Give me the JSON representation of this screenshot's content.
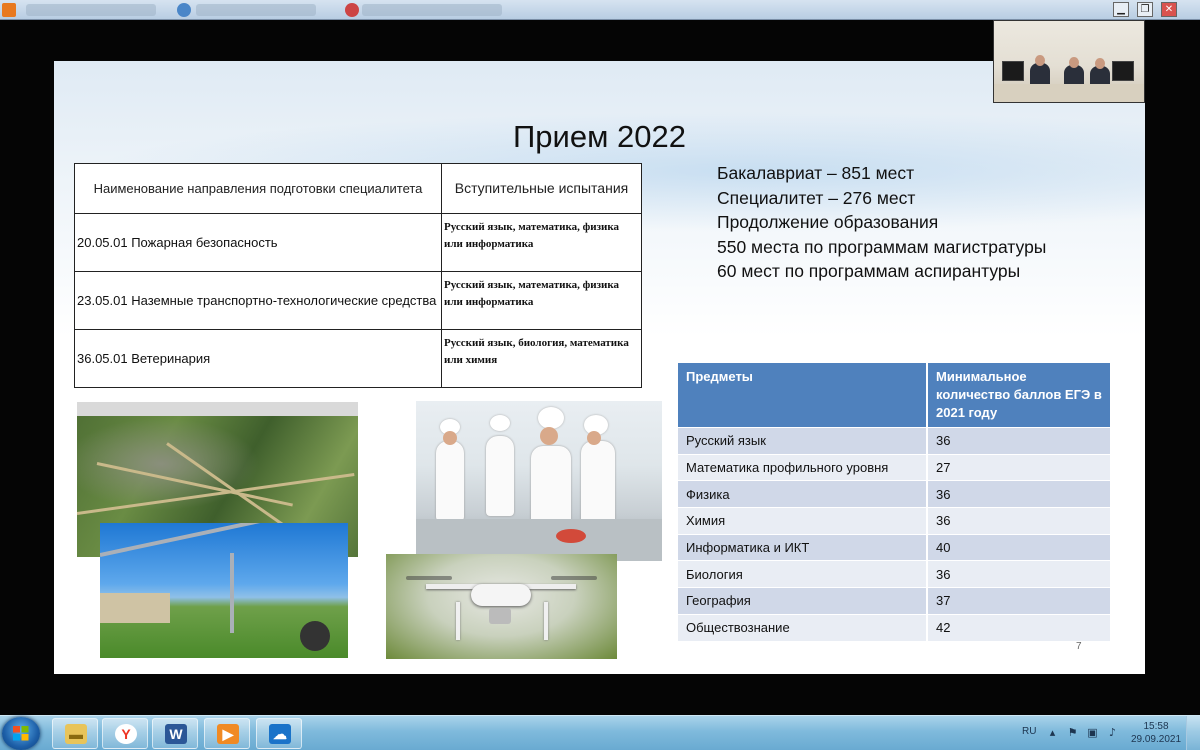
{
  "window": {
    "minimize_glyph": "▁",
    "maximize_glyph": "❐",
    "close_glyph": "✕"
  },
  "slide": {
    "title": "Прием 2022",
    "page_number": "7",
    "spec_table": {
      "headers": [
        "Наименование направления подготовки специалитета",
        "Вступительные испытания"
      ],
      "rows": [
        {
          "direction": "20.05.01 Пожарная безопасность",
          "exams": "Русский язык, математика, физика  или информатика"
        },
        {
          "direction": "23.05.01 Наземные транспортно-технологические средства",
          "exams": "Русский язык, математика, физика  или информатика"
        },
        {
          "direction": "36.05.01 Ветеринария",
          "exams": "Русский язык, биология, математика или химия"
        }
      ]
    },
    "info_lines": [
      "Бакалавриат – 851 мест",
      "Специалитет – 276 мест",
      "Продолжение образования",
      "550 места по программам магистратуры",
      "60 мест по программам аспирантуры"
    ],
    "subjects_table": {
      "headers": [
        "Предметы",
        "Минимальное количество баллов ЕГЭ в 2021 году"
      ],
      "rows": [
        {
          "subject": "Русский язык",
          "score": "36"
        },
        {
          "subject": "Математика профильного уровня",
          "score": "27"
        },
        {
          "subject": "Физика",
          "score": "36"
        },
        {
          "subject": "Химия",
          "score": "36"
        },
        {
          "subject": "Информатика и ИКТ",
          "score": "40"
        },
        {
          "subject": "Биология",
          "score": "36"
        },
        {
          "subject": "География",
          "score": "37"
        },
        {
          "subject": "Обществознание",
          "score": "42"
        }
      ]
    }
  },
  "taskbar": {
    "apps": [
      {
        "name": "file-explorer",
        "glyph": "▬"
      },
      {
        "name": "yandex-browser",
        "glyph": "Y"
      },
      {
        "name": "word",
        "glyph": "W"
      },
      {
        "name": "media-player",
        "glyph": "▶"
      },
      {
        "name": "cloud-app",
        "glyph": "☁"
      }
    ],
    "language": "RU",
    "time": "15:58",
    "date": "29.09.2021",
    "colors": {
      "header_blue": "#4f81bd",
      "row_odd": "#d0d8e8",
      "row_even": "#e9edf4"
    }
  }
}
